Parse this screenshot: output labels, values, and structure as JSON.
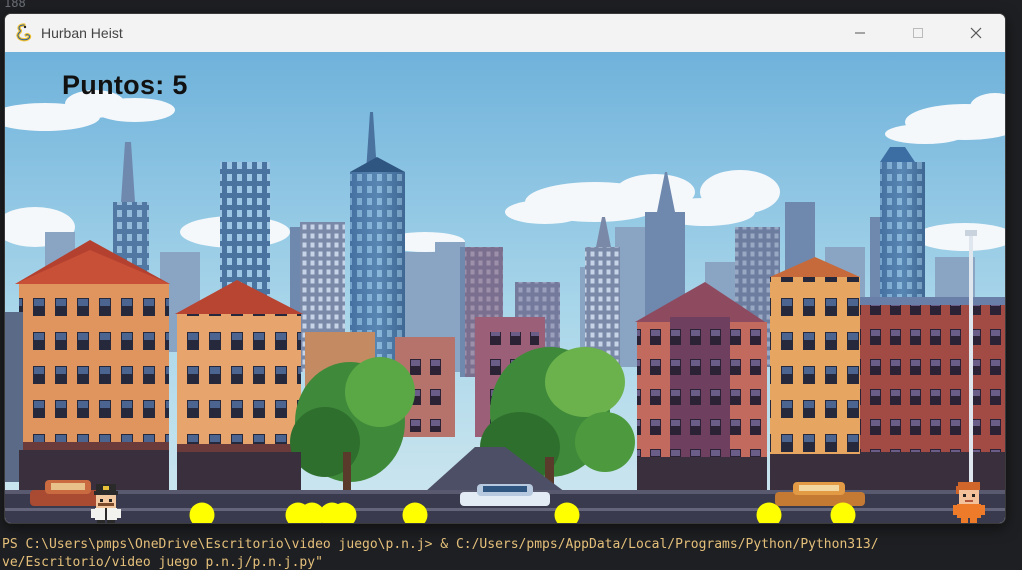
{
  "editor": {
    "line_number": "188"
  },
  "terminal": {
    "line1": "PS C:\\Users\\pmps\\OneDrive\\Escritorio\\video juego\\p.n.j> & C:/Users/pmps/AppData/Local/Programs/Python/Python313/",
    "line2": "ve/Escritorio/video juego p.n.j/p.n.j.py\""
  },
  "window": {
    "title": "Hurban Heist",
    "app_icon": "pygame-snake-icon",
    "controls": [
      "minimize-icon",
      "maximize-icon",
      "close-icon"
    ]
  },
  "game": {
    "score_label": "Puntos: 5",
    "coin_color": "#ffff00",
    "coin_count": 8,
    "player": "police-officer-sprite",
    "enemy": "orange-thief-sprite",
    "sky_color": "#8fc7e3",
    "road_color": "#3a3a4e"
  }
}
